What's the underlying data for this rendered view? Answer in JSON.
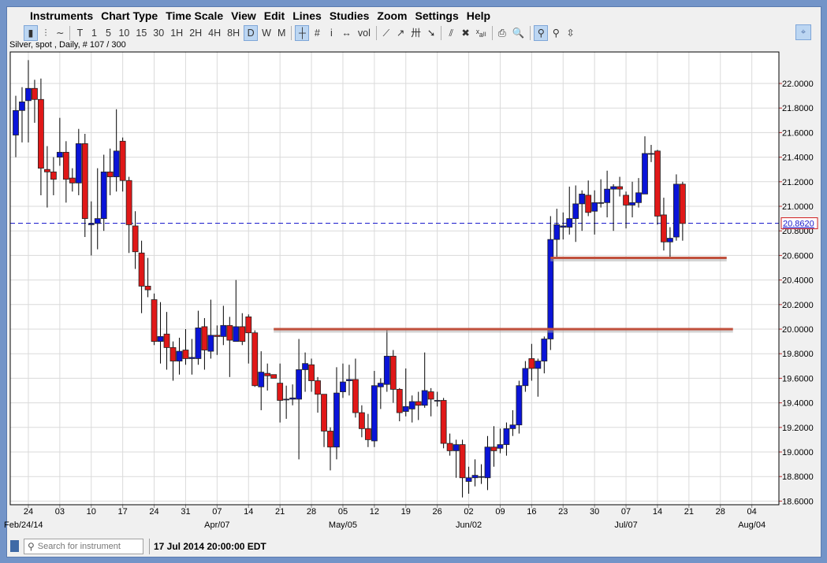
{
  "menu": [
    "Instruments",
    "Chart Type",
    "Time Scale",
    "View",
    "Edit",
    "Lines",
    "Studies",
    "Zoom",
    "Settings",
    "Help"
  ],
  "toolbar": {
    "chart_types": [
      {
        "icon": "candlestick-icon",
        "glyph": "▮"
      },
      {
        "icon": "bar-chart-icon",
        "glyph": "⫶"
      },
      {
        "icon": "line-chart-icon",
        "glyph": "∼"
      }
    ],
    "timeframes": [
      "T",
      "1",
      "5",
      "10",
      "15",
      "30",
      "1H",
      "2H",
      "4H",
      "8H",
      "D",
      "W",
      "M"
    ],
    "selected_timeframe": "D",
    "tools": [
      {
        "icon": "crosshair-icon",
        "glyph": "┼",
        "selected": true
      },
      {
        "icon": "grid-icon",
        "glyph": "#"
      },
      {
        "icon": "info-icon",
        "glyph": "i"
      },
      {
        "icon": "scroll-icon",
        "glyph": "↔"
      },
      {
        "icon": "volume-icon",
        "glyph": "vol"
      },
      {
        "icon": "trendline-icon",
        "glyph": "⟋"
      },
      {
        "icon": "ray-icon",
        "glyph": "↗"
      },
      {
        "icon": "fibonacci-icon",
        "glyph": "卅"
      },
      {
        "icon": "arrow-icon",
        "glyph": "➘"
      },
      {
        "icon": "delete-line-icon",
        "glyph": "⫽"
      },
      {
        "icon": "delete-icon",
        "glyph": "✖"
      },
      {
        "icon": "delete-all-icon",
        "glyph": "ˣₐₗₗ"
      },
      {
        "icon": "print-icon",
        "glyph": "⎙"
      },
      {
        "icon": "print-preview-icon",
        "glyph": "🔍"
      },
      {
        "icon": "zoom-in-icon",
        "glyph": "⚲",
        "selected": true
      },
      {
        "icon": "zoom-out-icon",
        "glyph": "⚲"
      },
      {
        "icon": "fit-icon",
        "glyph": "⇳"
      }
    ],
    "pin_icon": "⌖"
  },
  "chart_caption": "Silver, spot , Daily, # 107 / 300",
  "status": {
    "search_placeholder": "Search for instrument",
    "datetime": "17 Jul 2014 20:00:00 EDT"
  },
  "colors": {
    "up": "#0a14d8",
    "down": "#e01818",
    "hline": "#c0503c",
    "current": "#1a1acc",
    "grid": "#dadada"
  },
  "chart_data": {
    "type": "candlestick",
    "instrument": "Silver, spot",
    "ylim": [
      18.6,
      22.0
    ],
    "yticks": [
      "22.0000",
      "21.8000",
      "21.6000",
      "21.4000",
      "21.2000",
      "21.0000",
      "20.8000",
      "20.6000",
      "20.4000",
      "20.2000",
      "20.0000",
      "19.8000",
      "19.6000",
      "19.4000",
      "19.2000",
      "19.0000",
      "18.8000",
      "18.6000"
    ],
    "current_price": 20.862,
    "current_price_label": "20.8620",
    "xtick_labels": [
      "24",
      "03",
      "10",
      "17",
      "24",
      "31",
      "07",
      "14",
      "21",
      "28",
      "05",
      "12",
      "19",
      "26",
      "02",
      "09",
      "16",
      "23",
      "30",
      "07",
      "14",
      "21",
      "28",
      "04"
    ],
    "xtick_first_bar": 2,
    "bars_per_tick": 5,
    "major_labels": [
      {
        "tick": 0,
        "label": "Feb/24/14"
      },
      {
        "tick": 6,
        "label": "Apr/07"
      },
      {
        "tick": 10,
        "label": "May/05"
      },
      {
        "tick": 14,
        "label": "Jun/02"
      },
      {
        "tick": 19,
        "label": "Jul/07"
      },
      {
        "tick": 23,
        "label": "Aug/04"
      }
    ],
    "horizontal_lines": [
      {
        "price": 20.0,
        "from_bar": 41,
        "to_bar": 114
      },
      {
        "price": 20.58,
        "from_bar": 85,
        "to_bar": 113
      }
    ],
    "ohlc": [
      [
        21.58,
        21.9,
        21.4,
        21.78
      ],
      [
        21.78,
        21.97,
        21.52,
        21.85
      ],
      [
        21.86,
        22.19,
        21.52,
        21.96
      ],
      [
        21.96,
        22.03,
        21.68,
        21.87
      ],
      [
        21.87,
        22.04,
        21.09,
        21.31
      ],
      [
        21.3,
        21.49,
        20.99,
        21.28
      ],
      [
        21.28,
        21.4,
        21.09,
        21.22
      ],
      [
        21.4,
        21.72,
        21.33,
        21.44
      ],
      [
        21.44,
        21.53,
        21.03,
        21.22
      ],
      [
        21.23,
        21.31,
        21.12,
        21.19
      ],
      [
        21.19,
        21.63,
        21.09,
        21.51
      ],
      [
        21.51,
        21.59,
        20.75,
        20.9
      ],
      [
        20.85,
        21.04,
        20.6,
        20.86
      ],
      [
        20.86,
        21.31,
        20.65,
        20.9
      ],
      [
        20.9,
        21.42,
        20.8,
        21.28
      ],
      [
        21.28,
        21.47,
        21.09,
        21.24
      ],
      [
        21.24,
        21.79,
        21.12,
        21.45
      ],
      [
        21.53,
        21.56,
        21.12,
        21.21
      ],
      [
        21.21,
        21.24,
        20.62,
        20.85
      ],
      [
        20.84,
        20.96,
        20.49,
        20.63
      ],
      [
        20.62,
        20.72,
        20.13,
        20.35
      ],
      [
        20.35,
        20.58,
        20.26,
        20.32
      ],
      [
        20.24,
        20.29,
        19.87,
        19.9
      ],
      [
        19.9,
        20.22,
        19.72,
        19.94
      ],
      [
        19.96,
        20.14,
        19.67,
        19.85
      ],
      [
        19.85,
        19.9,
        19.58,
        19.74
      ],
      [
        19.74,
        19.93,
        19.63,
        19.82
      ],
      [
        19.83,
        20.0,
        19.71,
        19.76
      ],
      [
        19.76,
        19.92,
        19.63,
        19.77
      ],
      [
        19.76,
        20.15,
        19.71,
        20.01
      ],
      [
        20.02,
        20.09,
        19.67,
        19.83
      ],
      [
        19.82,
        20.24,
        19.76,
        19.95
      ],
      [
        19.95,
        20.03,
        19.79,
        19.94
      ],
      [
        19.94,
        20.19,
        19.87,
        20.03
      ],
      [
        20.03,
        20.1,
        19.61,
        19.91
      ],
      [
        19.9,
        20.4,
        19.9,
        20.02
      ],
      [
        20.02,
        20.13,
        19.87,
        19.9
      ],
      [
        20.1,
        20.12,
        19.72,
        19.97
      ],
      [
        19.97,
        19.99,
        19.53,
        19.54
      ],
      [
        19.53,
        19.82,
        19.34,
        19.65
      ],
      [
        19.64,
        19.72,
        19.5,
        19.62
      ],
      [
        19.63,
        19.63,
        19.6,
        19.6
      ],
      [
        19.56,
        19.72,
        19.24,
        19.42
      ],
      [
        19.43,
        19.54,
        19.27,
        19.43
      ],
      [
        19.43,
        19.55,
        19.38,
        19.44
      ],
      [
        19.43,
        19.92,
        18.94,
        19.67
      ],
      [
        19.67,
        19.81,
        19.49,
        19.72
      ],
      [
        19.71,
        19.76,
        19.49,
        19.58
      ],
      [
        19.58,
        19.61,
        19.32,
        19.47
      ],
      [
        19.47,
        19.47,
        19.04,
        19.17
      ],
      [
        19.17,
        19.2,
        18.85,
        19.04
      ],
      [
        19.04,
        19.69,
        18.94,
        19.48
      ],
      [
        19.49,
        19.72,
        19.44,
        19.57
      ],
      [
        19.58,
        19.71,
        19.46,
        19.59
      ],
      [
        19.59,
        19.76,
        19.28,
        19.32
      ],
      [
        19.32,
        19.38,
        19.12,
        19.19
      ],
      [
        19.19,
        19.31,
        19.04,
        19.1
      ],
      [
        19.09,
        19.66,
        19.04,
        19.54
      ],
      [
        19.53,
        19.6,
        19.35,
        19.56
      ],
      [
        19.55,
        20.0,
        19.49,
        19.78
      ],
      [
        19.78,
        19.83,
        19.4,
        19.51
      ],
      [
        19.51,
        19.52,
        19.25,
        19.32
      ],
      [
        19.33,
        19.68,
        19.29,
        19.37
      ],
      [
        19.35,
        19.46,
        19.24,
        19.41
      ],
      [
        19.41,
        19.49,
        19.26,
        19.38
      ],
      [
        19.38,
        19.81,
        19.36,
        19.5
      ],
      [
        19.49,
        19.52,
        19.29,
        19.43
      ],
      [
        19.42,
        19.49,
        19.37,
        19.42
      ],
      [
        19.42,
        19.44,
        19.03,
        19.07
      ],
      [
        19.07,
        19.15,
        18.97,
        19.01
      ],
      [
        19.01,
        19.1,
        18.79,
        19.06
      ],
      [
        19.06,
        19.1,
        18.63,
        18.79
      ],
      [
        18.76,
        18.88,
        18.66,
        18.79
      ],
      [
        18.79,
        18.94,
        18.72,
        18.81
      ],
      [
        18.8,
        18.9,
        18.74,
        18.8
      ],
      [
        18.79,
        19.13,
        18.69,
        19.04
      ],
      [
        19.04,
        19.21,
        18.88,
        19.01
      ],
      [
        19.03,
        19.19,
        18.99,
        19.06
      ],
      [
        19.06,
        19.24,
        18.97,
        19.19
      ],
      [
        19.19,
        19.34,
        19.13,
        19.22
      ],
      [
        19.22,
        19.58,
        19.15,
        19.54
      ],
      [
        19.54,
        19.74,
        19.49,
        19.68
      ],
      [
        19.76,
        19.88,
        19.58,
        19.68
      ],
      [
        19.68,
        19.76,
        19.45,
        19.74
      ],
      [
        19.74,
        19.94,
        19.64,
        19.92
      ],
      [
        19.92,
        20.92,
        19.83,
        20.73
      ],
      [
        20.73,
        20.98,
        20.59,
        20.85
      ],
      [
        20.83,
        20.95,
        20.73,
        20.84
      ],
      [
        20.83,
        21.16,
        20.77,
        20.9
      ],
      [
        20.9,
        21.17,
        20.71,
        21.02
      ],
      [
        21.02,
        21.13,
        20.8,
        21.1
      ],
      [
        21.09,
        21.21,
        20.92,
        20.95
      ],
      [
        20.96,
        21.13,
        20.77,
        21.03
      ],
      [
        21.03,
        21.22,
        20.99,
        21.03
      ],
      [
        21.03,
        21.29,
        20.91,
        21.14
      ],
      [
        21.14,
        21.18,
        20.8,
        21.16
      ],
      [
        21.16,
        21.24,
        21.08,
        21.14
      ],
      [
        21.09,
        21.12,
        20.82,
        21.01
      ],
      [
        21.01,
        21.2,
        20.91,
        21.03
      ],
      [
        21.03,
        21.23,
        20.99,
        21.11
      ],
      [
        21.1,
        21.57,
        21.1,
        21.43
      ],
      [
        21.43,
        21.5,
        21.36,
        21.43
      ],
      [
        21.45,
        21.46,
        20.85,
        20.92
      ],
      [
        20.93,
        21.07,
        20.64,
        20.71
      ],
      [
        20.71,
        20.83,
        20.58,
        20.74
      ],
      [
        20.75,
        21.26,
        20.72,
        21.18
      ],
      [
        21.18,
        21.2,
        20.72,
        20.86
      ]
    ]
  }
}
